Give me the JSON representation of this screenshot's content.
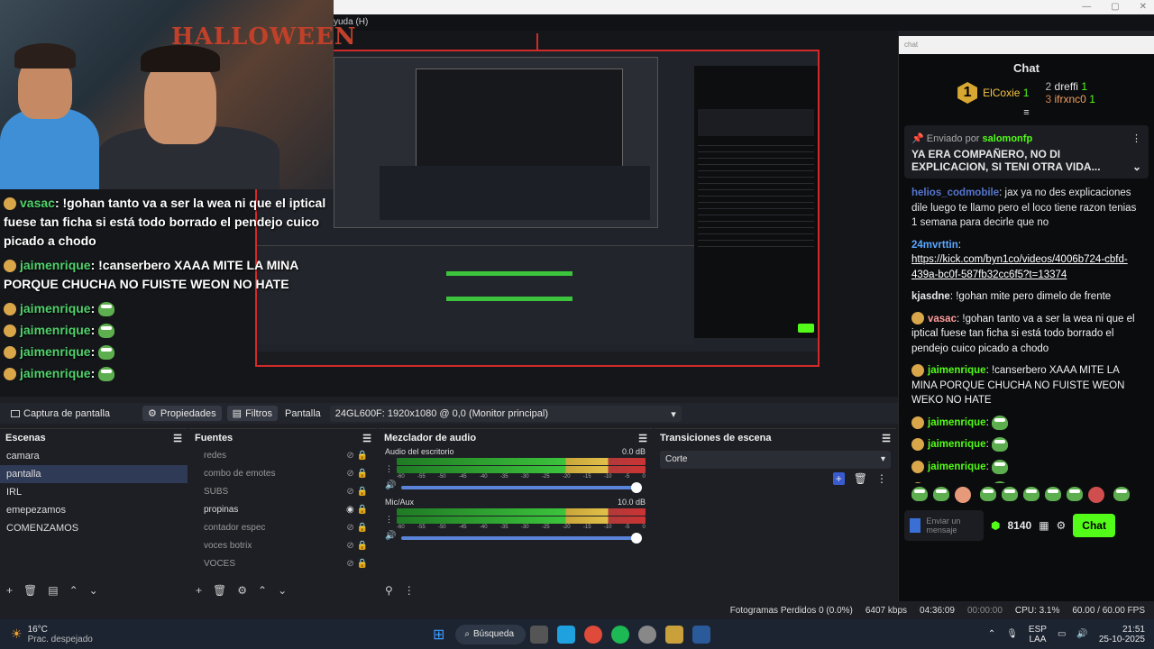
{
  "window": {
    "menu_fragment": "yuda (H)"
  },
  "webcam": {
    "decor_text": "HALLOWEEN"
  },
  "overlay_chat": [
    {
      "name": "vasac",
      "text": ": !gohan tanto va a ser la wea ni que el iptical fuese tan ficha si está todo borrado el pendejo cuico picado a chodo"
    },
    {
      "name": "jaimenrique",
      "text": ": !canserbero XAAA MITE LA MINA PORQUE CHUCHA NO FUISTE WEON NO HATE"
    },
    {
      "name": "jaimenrique",
      "text": ":"
    },
    {
      "name": "jaimenrique",
      "text": ":"
    },
    {
      "name": "jaimenrique",
      "text": ":"
    },
    {
      "name": "jaimenrique",
      "text": ":"
    }
  ],
  "source_toolbar": {
    "source_name": "Captura de pantalla",
    "properties": "Propiedades",
    "filters": "Filtros",
    "display_label": "Pantalla",
    "display_value": "24GL600F: 1920x1080 @ 0,0 (Monitor principal)"
  },
  "scenes": {
    "title": "Escenas",
    "items": [
      "camara",
      "pantalla",
      "IRL",
      "emepezamos",
      "COMENZAMOS"
    ],
    "active": 1
  },
  "sources": {
    "title": "Fuentes",
    "items": [
      {
        "name": "redes",
        "visible": false
      },
      {
        "name": "combo de emotes",
        "visible": false
      },
      {
        "name": "SUBS",
        "visible": false
      },
      {
        "name": "propinas",
        "visible": true
      },
      {
        "name": "contador espec",
        "visible": false
      },
      {
        "name": "voces botrix",
        "visible": false
      },
      {
        "name": "VOCES",
        "visible": false
      }
    ]
  },
  "mixer": {
    "title": "Mezclador de audio",
    "channels": [
      {
        "name": "Audio del escritorio",
        "db": "0.0 dB",
        "level": 0.86
      },
      {
        "name": "Mic/Aux",
        "db": "10.0 dB",
        "level": 0.84
      }
    ],
    "scale": [
      "-60",
      "-55",
      "-50",
      "-45",
      "-40",
      "-35",
      "-30",
      "-25",
      "-20",
      "-15",
      "-10",
      "-5",
      "0"
    ]
  },
  "transitions": {
    "title": "Transiciones de escena",
    "value": "Corte"
  },
  "status_bar": {
    "dropped": "Fotogramas Perdidos 0 (0.0%)",
    "bitrate": "6407 kbps",
    "live_time": "04:36:09",
    "rec_time": "00:00:00",
    "cpu": "CPU: 3.1%",
    "fps": "60.00 / 60.00 FPS"
  },
  "taskbar": {
    "weather_temp": "16°C",
    "weather_desc": "Prac. despejado",
    "search": "Búsqueda",
    "lang": "ESP",
    "lang_sub": "LAA",
    "time": "21:51",
    "date": "25-10-2025"
  },
  "chat": {
    "window_title": "chat",
    "title": "Chat",
    "leaderboard": [
      {
        "rank": "1",
        "name": "ElCoxie",
        "count": "1"
      },
      {
        "rank": "2",
        "name": "dreffi",
        "count": "1"
      },
      {
        "rank": "3",
        "name": "ifrxnc0",
        "count": "1"
      }
    ],
    "pinned": {
      "label": "Enviado por",
      "author": "salomonfp",
      "text": "YA ERA COMPAÑERO, NO DI EXPLICACION, SI TENI OTRA VIDA..."
    },
    "messages": [
      {
        "name": "helios_codmobile",
        "text": ": jax ya no des explicaciones dile luego te llamo pero el loco tiene razon tenias 1 semana para decirle que no"
      },
      {
        "name": "24mvrttin",
        "text": ":",
        "link": "https://kick.com/byn1co/videos/4006b724-cbfd-439a-bc0f-587fb32cc6f5?t=13374"
      },
      {
        "name": "kjasdne",
        "text": ": !gohan mite pero dimelo de frente"
      },
      {
        "name": "vasac",
        "text": ": !gohan tanto va a ser la wea ni que el iptical fuese tan ficha si está todo borrado el pendejo cuico picado a chodo"
      },
      {
        "name": "jaimenrique",
        "text": ": !canserbero XAAA MITE LA MINA PORQUE CHUCHA NO FUISTE WEON WEKO NO HATE"
      },
      {
        "name": "jaimenrique",
        "text": ":"
      },
      {
        "name": "jaimenrique",
        "text": ":"
      },
      {
        "name": "jaimenrique",
        "text": ":"
      },
      {
        "name": "jaimenrique",
        "text": ":"
      }
    ],
    "input_placeholder": "Enviar un mensaje",
    "points": "8140",
    "send": "Chat"
  },
  "colors": {
    "kick_green": "#53fc18",
    "obs_bg": "#1d1f24",
    "selection": "#2f3a57"
  }
}
